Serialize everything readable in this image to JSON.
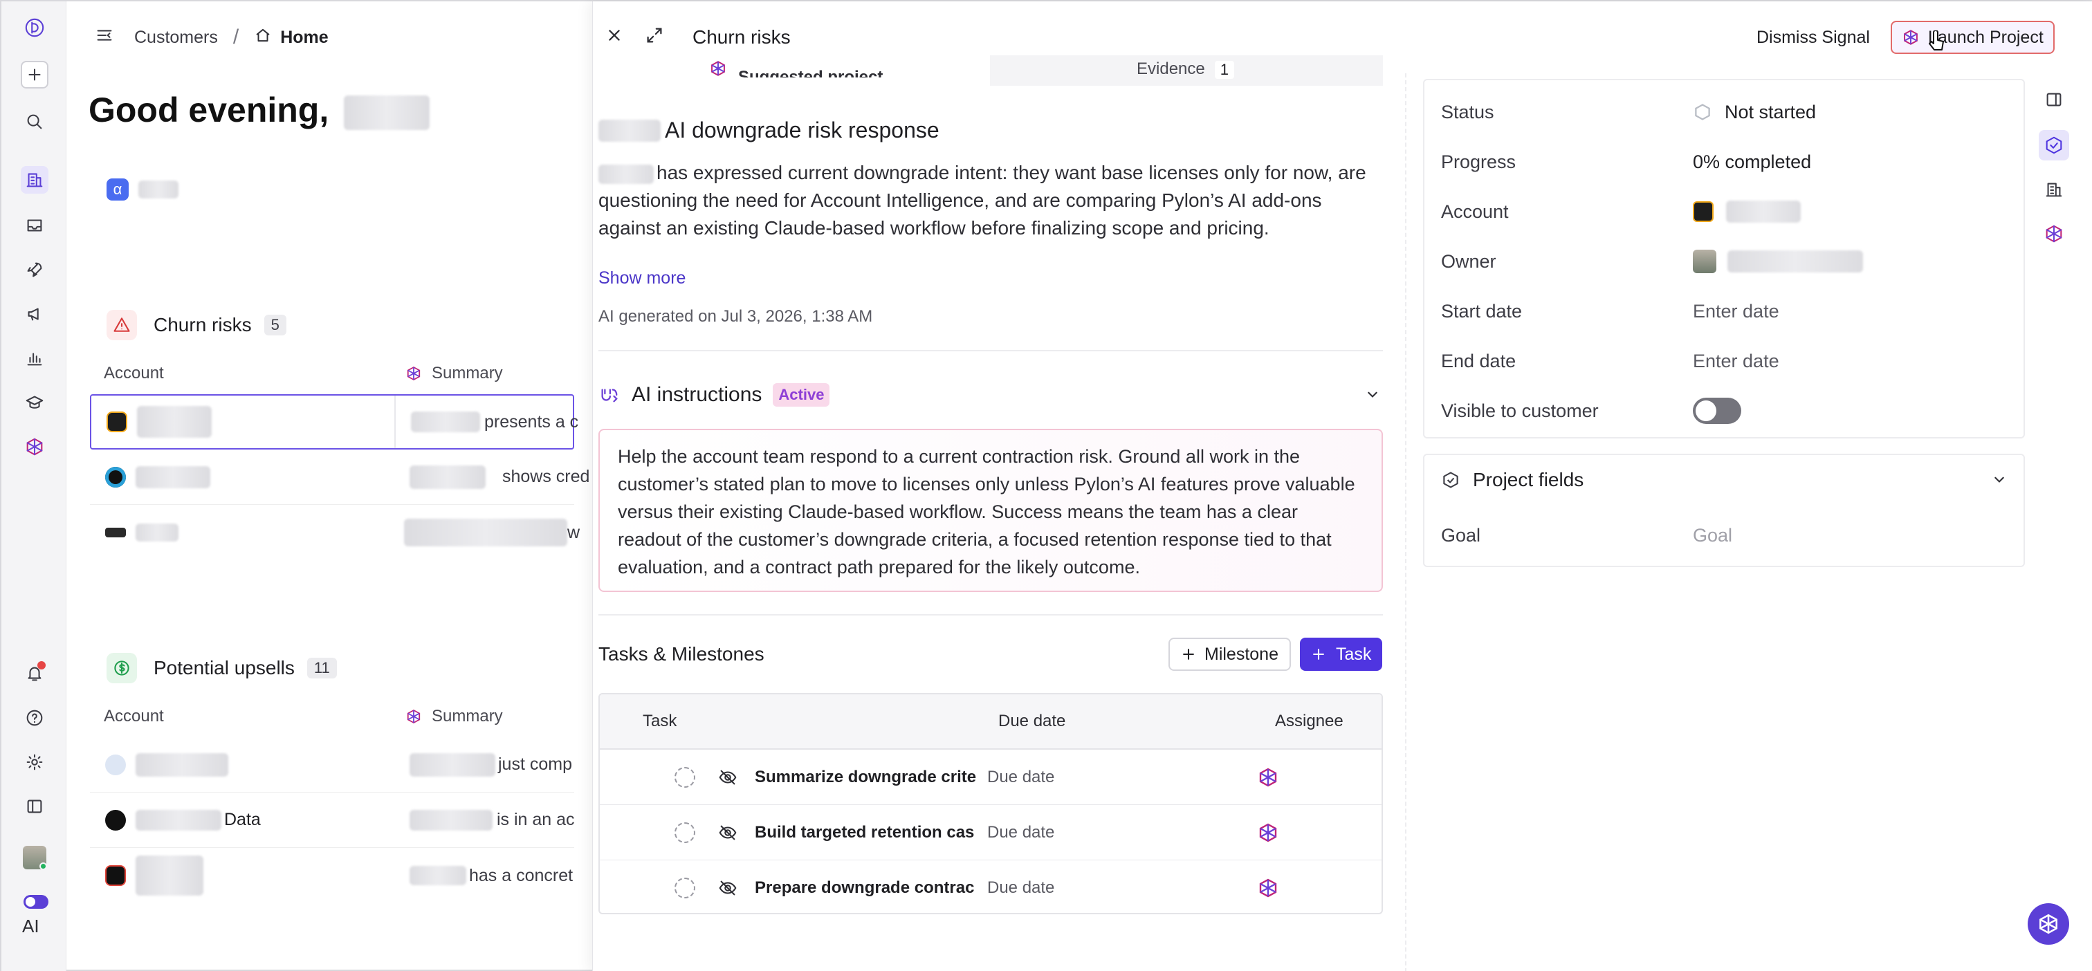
{
  "breadcrumb": {
    "parent": "Customers",
    "sep": "/",
    "current": "Home"
  },
  "greeting": "Good evening,",
  "org_initial": "α",
  "churn": {
    "title": "Churn risks",
    "count": "5",
    "col_account": "Account",
    "col_summary": "Summary",
    "rows": [
      {
        "summary": "presents a c"
      },
      {
        "summary": "shows cred"
      },
      {
        "summary": "w"
      }
    ]
  },
  "upsells": {
    "title": "Potential upsells",
    "count": "11",
    "col_account": "Account",
    "col_summary": "Summary",
    "rows": [
      {
        "account": "",
        "summary": "just comp"
      },
      {
        "account": "Data",
        "summary": "is in an ac"
      },
      {
        "account": "",
        "summary": "has a concret"
      }
    ]
  },
  "rail": {
    "ai_label": "AI"
  },
  "panel": {
    "title": "Churn risks",
    "dismiss": "Dismiss Signal",
    "launch": "Launch Project",
    "suggested": "Suggested project",
    "evidence": "Evidence",
    "evidence_count": "1",
    "heading": "AI downgrade risk response",
    "description": "has expressed current downgrade intent: they want base licenses only for now, are questioning the need for Account Intelligence, and are comparing Pylon’s AI add-ons against an existing Claude-based workflow before finalizing scope and pricing.",
    "show_more": "Show more",
    "generated": "AI generated on Jul 3, 2026, 1:38 AM",
    "instructions_title": "AI instructions",
    "instructions_badge": "Active",
    "instructions_text": "Help the account team respond to a current contraction risk. Ground all work in the customer’s stated plan to move to licenses only unless Pylon’s AI features prove valuable versus their existing Claude-based workflow. Success means the team has a clear readout of the customer’s downgrade criteria, a focused retention response tied to that evaluation, and a contract path prepared for the likely outcome.",
    "tasks_title": "Tasks & Milestones",
    "milestone_btn": "Milestone",
    "task_btn": "Task",
    "col_task": "Task",
    "col_due": "Due date",
    "col_assignee": "Assignee",
    "tasks": [
      {
        "name": "Summarize downgrade crite",
        "due": "Due date"
      },
      {
        "name": "Build targeted retention cas",
        "due": "Due date"
      },
      {
        "name": "Prepare downgrade contrac",
        "due": "Due date"
      }
    ]
  },
  "props": {
    "status_label": "Status",
    "status_value": "Not started",
    "progress_label": "Progress",
    "progress_value": "0% completed",
    "account_label": "Account",
    "owner_label": "Owner",
    "start_label": "Start date",
    "start_value": "Enter date",
    "end_label": "End date",
    "end_value": "Enter date",
    "visible_label": "Visible to customer",
    "visible_on": false
  },
  "project_fields": {
    "title": "Project fields",
    "goal_label": "Goal",
    "goal_placeholder": "Goal"
  },
  "colors": {
    "accent": "#4f35e0",
    "badge_bg": "#f9d9ea",
    "danger": "#e64545"
  }
}
